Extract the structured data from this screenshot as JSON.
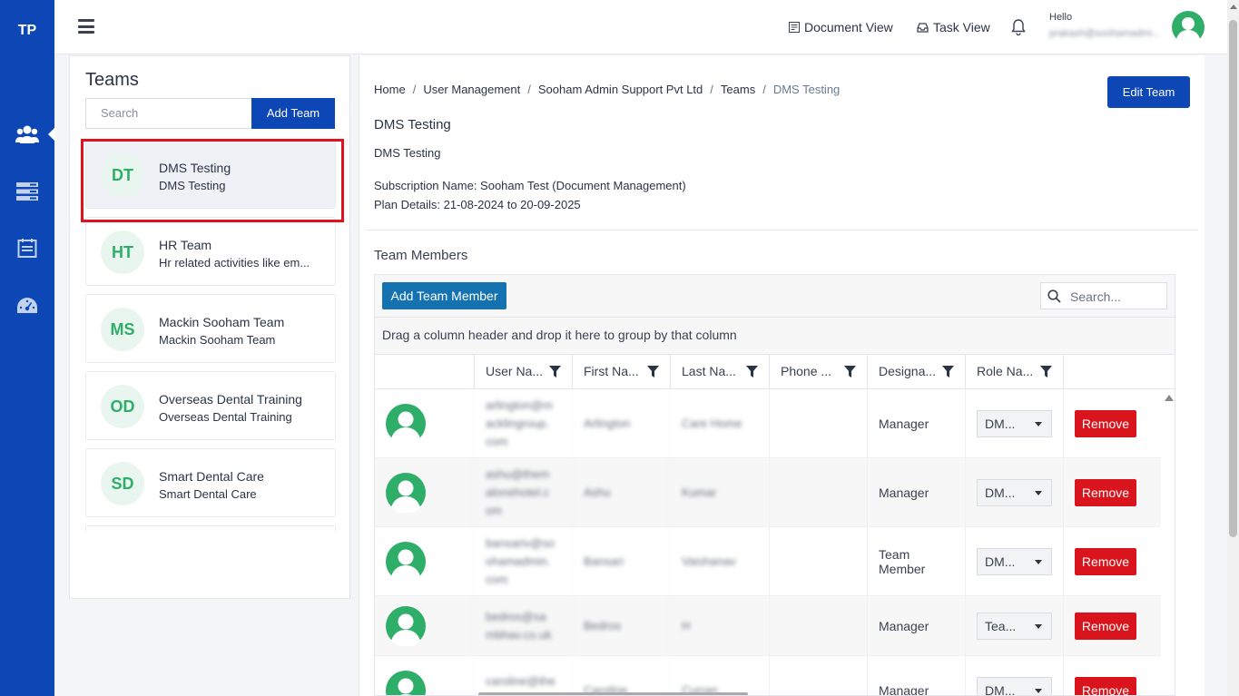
{
  "rail": {
    "logo": "TP",
    "items": [
      {
        "icon": "users-icon",
        "active": true
      },
      {
        "icon": "list-layout-icon",
        "active": false
      },
      {
        "icon": "task-board-icon",
        "active": false
      },
      {
        "icon": "dashboard-gauge-icon",
        "active": false
      }
    ]
  },
  "header": {
    "document_view": "Document View",
    "task_view": "Task View",
    "hello": "Hello",
    "user_email": "prakash@soohamadmi..."
  },
  "teams": {
    "title": "Teams",
    "search_placeholder": "Search",
    "add_button": "Add Team",
    "list": [
      {
        "initials": "DT",
        "name": "DMS Testing",
        "description": "DMS Testing",
        "selected": true
      },
      {
        "initials": "HT",
        "name": "HR Team",
        "description": "Hr related activities like em..."
      },
      {
        "initials": "MS",
        "name": "Mackin Sooham Team",
        "description": "Mackin Sooham Team"
      },
      {
        "initials": "OD",
        "name": "Overseas Dental Training",
        "description": "Overseas Dental Training"
      },
      {
        "initials": "SD",
        "name": "Smart Dental Care",
        "description": "Smart Dental Care"
      }
    ]
  },
  "breadcrumb": [
    "Home",
    "User Management",
    "Sooham Admin Support Pvt Ltd",
    "Teams",
    "DMS Testing"
  ],
  "team_detail": {
    "edit_button": "Edit Team",
    "name": "DMS Testing",
    "description": "DMS Testing",
    "subscription": "Subscription Name: Sooham Test (Document Management)",
    "plan": "Plan Details: 21-08-2024 to 20-09-2025"
  },
  "members": {
    "heading": "Team Members",
    "add_button": "Add Team Member",
    "search_placeholder": "Search...",
    "group_hint": "Drag a column header and drop it here to group by that column",
    "columns": [
      "User Na...",
      "First Na...",
      "Last Na...",
      "Phone ...",
      "Designa...",
      "Role Na..."
    ],
    "remove_label": "Remove",
    "rows": [
      {
        "user": "arlington@m\nacklingroup.\ncom",
        "first": "Arlington",
        "last": "Care Home",
        "phone": "",
        "designation": "Manager",
        "role": "DM..."
      },
      {
        "user": "ashu@them\nalonehotel.c\nom",
        "first": "Ashu",
        "last": "Kumar",
        "phone": "",
        "designation": "Manager",
        "role": "DM..."
      },
      {
        "user": "bansariv@so\nohamadmin.\ncom",
        "first": "Bansari",
        "last": "Vaishanav",
        "phone": "",
        "designation": "Team\nMember",
        "role": "DM..."
      },
      {
        "user": "bedros@sa\nmbhav.co.uk",
        "first": "Bedros",
        "last": "H",
        "phone": "",
        "designation": "Manager",
        "role": "Tea..."
      },
      {
        "user": "caroline@the\nmalonehotel.",
        "first": "Caroline",
        "last": "Curran",
        "phone": "",
        "designation": "Manager",
        "role": "DM..."
      }
    ]
  }
}
